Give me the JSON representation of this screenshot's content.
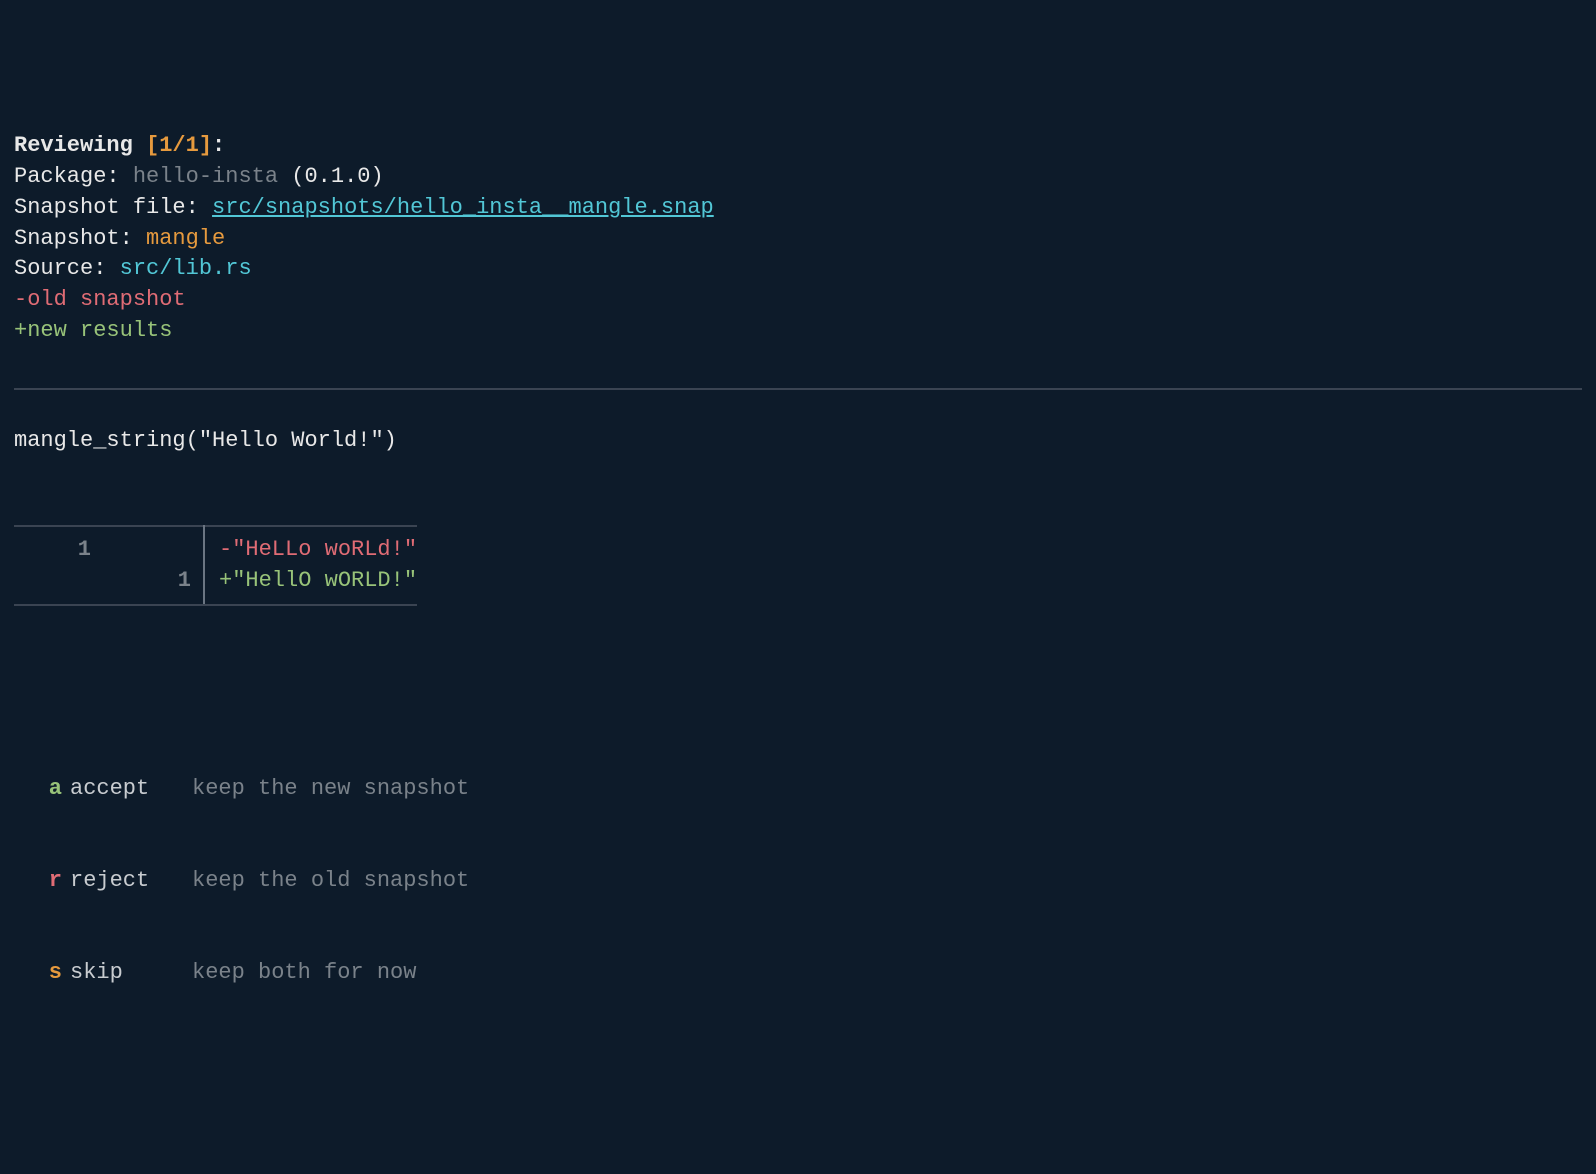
{
  "header": {
    "reviewing_label": "Reviewing",
    "counter": "[1/1]",
    "colon": ":",
    "package_label": "Package:",
    "package_name": "hello-insta",
    "package_version": "(0.1.0)",
    "snapshot_file_label": "Snapshot file:",
    "snapshot_file_path": "src/snapshots/hello_insta__mangle.snap",
    "snapshot_label": "Snapshot:",
    "snapshot_name": "mangle",
    "source_label": "Source:",
    "source_path": "src/lib.rs",
    "old_marker": "-old snapshot",
    "new_marker": "+new results"
  },
  "expression": "mangle_string(\"Hello World!\")",
  "diff": {
    "old_line_no": "1",
    "new_line_no": "1",
    "old_line": "-\"HeLLo woRLd!\"",
    "new_line": "+\"HellO wORLD!\""
  },
  "options": {
    "accept": {
      "key": "a",
      "label": "accept",
      "desc": "keep the new snapshot"
    },
    "reject": {
      "key": "r",
      "label": "reject",
      "desc": "keep the old snapshot"
    },
    "skip": {
      "key": "s",
      "label": "skip",
      "desc": "keep both for now"
    }
  }
}
